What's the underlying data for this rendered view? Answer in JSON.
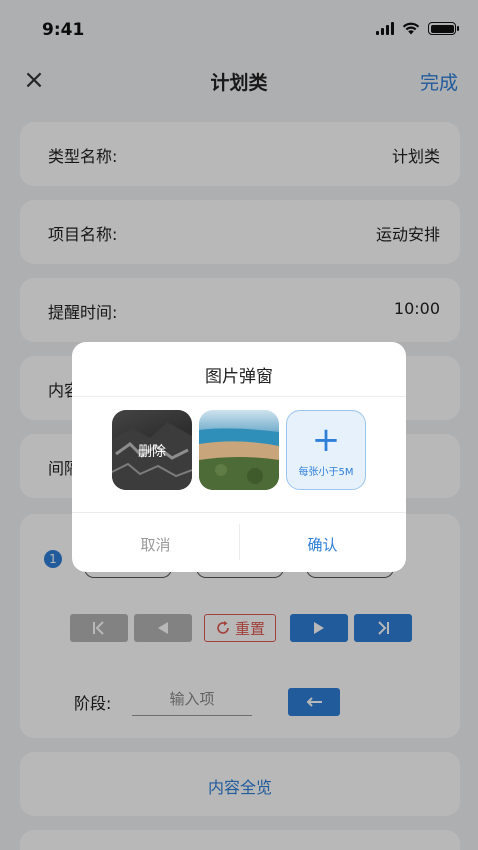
{
  "status_bar": {
    "time": "9:41"
  },
  "nav": {
    "close_icon": "×",
    "title": "计划类",
    "done_label": "完成"
  },
  "form_rows": [
    {
      "label": "类型名称:",
      "value": "计划类"
    },
    {
      "label": "项目名称:",
      "value": "运动安排"
    },
    {
      "label": "提醒时间:",
      "value": "10:00"
    },
    {
      "label": "内容",
      "value": ""
    },
    {
      "label": "间隔",
      "value": ""
    }
  ],
  "controls": {
    "step_number": "1",
    "first_icon": "skip-start-icon",
    "prev_icon": "play-back-icon",
    "reset_label": "重置",
    "play_icon": "play-icon",
    "last_icon": "skip-end-icon",
    "stage_label": "阶段:",
    "stage_placeholder": "输入项",
    "enter_icon": "enter-arrow-icon"
  },
  "overview": {
    "label": "内容全览"
  },
  "modal": {
    "title": "图片弹窗",
    "delete_label": "删除",
    "add_hint": "每张小于5M",
    "cancel_label": "取消",
    "confirm_label": "确认"
  },
  "colors": {
    "accent": "#2f7fd9",
    "danger": "#e15a52",
    "background": "#f2f3f5"
  }
}
